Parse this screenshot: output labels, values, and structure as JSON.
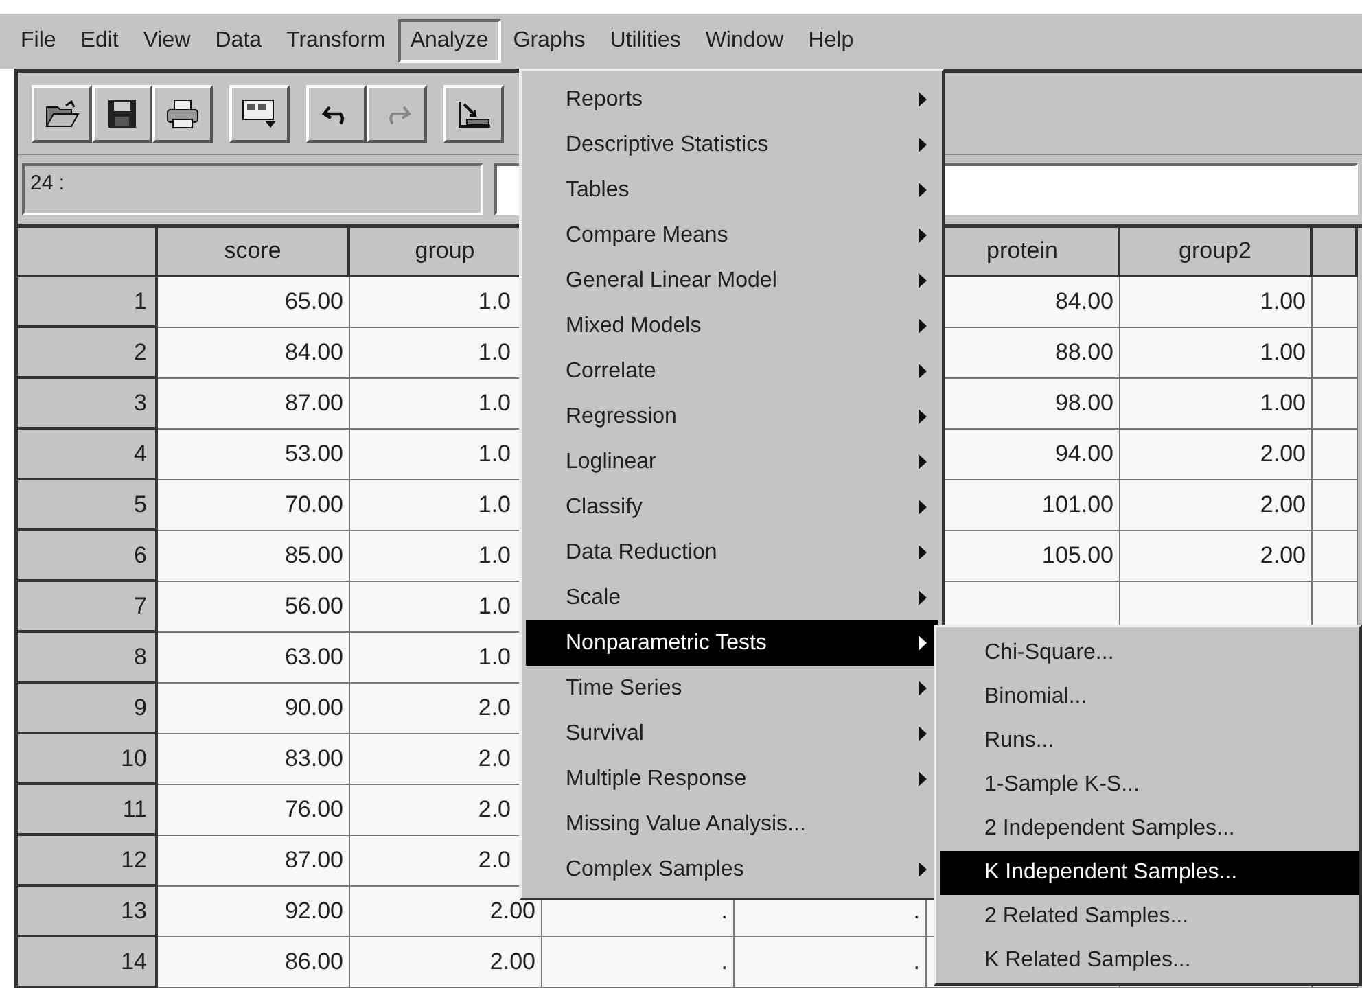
{
  "menu_bar": [
    {
      "label": "File",
      "selected": false
    },
    {
      "label": "Edit",
      "selected": false
    },
    {
      "label": "View",
      "selected": false
    },
    {
      "label": "Data",
      "selected": false
    },
    {
      "label": "Transform",
      "selected": false
    },
    {
      "label": "Analyze",
      "selected": true
    },
    {
      "label": "Graphs",
      "selected": false
    },
    {
      "label": "Utilities",
      "selected": false
    },
    {
      "label": "Window",
      "selected": false
    },
    {
      "label": "Help",
      "selected": false
    }
  ],
  "cell_editor": {
    "cell_reference": "24 :"
  },
  "table": {
    "columns": [
      "score",
      "group",
      null,
      null,
      "protein",
      "group2",
      null
    ],
    "rows": [
      {
        "number": "1",
        "cells": [
          "65.00",
          "1.0",
          null,
          null,
          "84.00",
          "1.00",
          null
        ]
      },
      {
        "number": "2",
        "cells": [
          "84.00",
          "1.0",
          null,
          null,
          "88.00",
          "1.00",
          null
        ]
      },
      {
        "number": "3",
        "cells": [
          "87.00",
          "1.0",
          null,
          null,
          "98.00",
          "1.00",
          null
        ]
      },
      {
        "number": "4",
        "cells": [
          "53.00",
          "1.0",
          null,
          null,
          "94.00",
          "2.00",
          null
        ]
      },
      {
        "number": "5",
        "cells": [
          "70.00",
          "1.0",
          null,
          null,
          "101.00",
          "2.00",
          null
        ]
      },
      {
        "number": "6",
        "cells": [
          "85.00",
          "1.0",
          null,
          null,
          "105.00",
          "2.00",
          null
        ]
      },
      {
        "number": "7",
        "cells": [
          "56.00",
          "1.0",
          null,
          null,
          null,
          null,
          null
        ]
      },
      {
        "number": "8",
        "cells": [
          "63.00",
          "1.0",
          null,
          null,
          null,
          null,
          null
        ]
      },
      {
        "number": "9",
        "cells": [
          "90.00",
          "2.0",
          null,
          null,
          null,
          null,
          null
        ]
      },
      {
        "number": "10",
        "cells": [
          "83.00",
          "2.0",
          null,
          null,
          null,
          null,
          null
        ]
      },
      {
        "number": "11",
        "cells": [
          "76.00",
          "2.0",
          null,
          null,
          null,
          null,
          null
        ]
      },
      {
        "number": "12",
        "cells": [
          "87.00",
          "2.0",
          null,
          null,
          null,
          null,
          null
        ]
      },
      {
        "number": "13",
        "cells": [
          "92.00",
          "2.00",
          ".",
          ".",
          null,
          null,
          null
        ]
      },
      {
        "number": "14",
        "cells": [
          "86.00",
          "2.00",
          ".",
          ".",
          null,
          null,
          null
        ]
      }
    ]
  },
  "analyze_menu": [
    {
      "label": "Reports",
      "has_submenu": true,
      "selected": false
    },
    {
      "label": "Descriptive Statistics",
      "has_submenu": true,
      "selected": false
    },
    {
      "label": "Tables",
      "has_submenu": true,
      "selected": false
    },
    {
      "label": "Compare Means",
      "has_submenu": true,
      "selected": false
    },
    {
      "label": "General Linear Model",
      "has_submenu": true,
      "selected": false
    },
    {
      "label": "Mixed Models",
      "has_submenu": true,
      "selected": false
    },
    {
      "label": "Correlate",
      "has_submenu": true,
      "selected": false
    },
    {
      "label": "Regression",
      "has_submenu": true,
      "selected": false
    },
    {
      "label": "Loglinear",
      "has_submenu": true,
      "selected": false
    },
    {
      "label": "Classify",
      "has_submenu": true,
      "selected": false
    },
    {
      "label": "Data Reduction",
      "has_submenu": true,
      "selected": false
    },
    {
      "label": "Scale",
      "has_submenu": true,
      "selected": false
    },
    {
      "label": "Nonparametric Tests",
      "has_submenu": true,
      "selected": true
    },
    {
      "label": "Time Series",
      "has_submenu": true,
      "selected": false
    },
    {
      "label": "Survival",
      "has_submenu": true,
      "selected": false
    },
    {
      "label": "Multiple Response",
      "has_submenu": true,
      "selected": false
    },
    {
      "label": "Missing Value Analysis...",
      "has_submenu": false,
      "selected": false
    },
    {
      "label": "Complex Samples",
      "has_submenu": true,
      "selected": false
    }
  ],
  "nonparametric_submenu": [
    {
      "label": "Chi-Square...",
      "selected": false
    },
    {
      "label": "Binomial...",
      "selected": false
    },
    {
      "label": "Runs...",
      "selected": false
    },
    {
      "label": "1-Sample K-S...",
      "selected": false
    },
    {
      "label": "2 Independent Samples...",
      "selected": false
    },
    {
      "label": "K Independent Samples...",
      "selected": true
    },
    {
      "label": "2 Related Samples...",
      "selected": false
    },
    {
      "label": "K Related Samples...",
      "selected": false
    }
  ]
}
